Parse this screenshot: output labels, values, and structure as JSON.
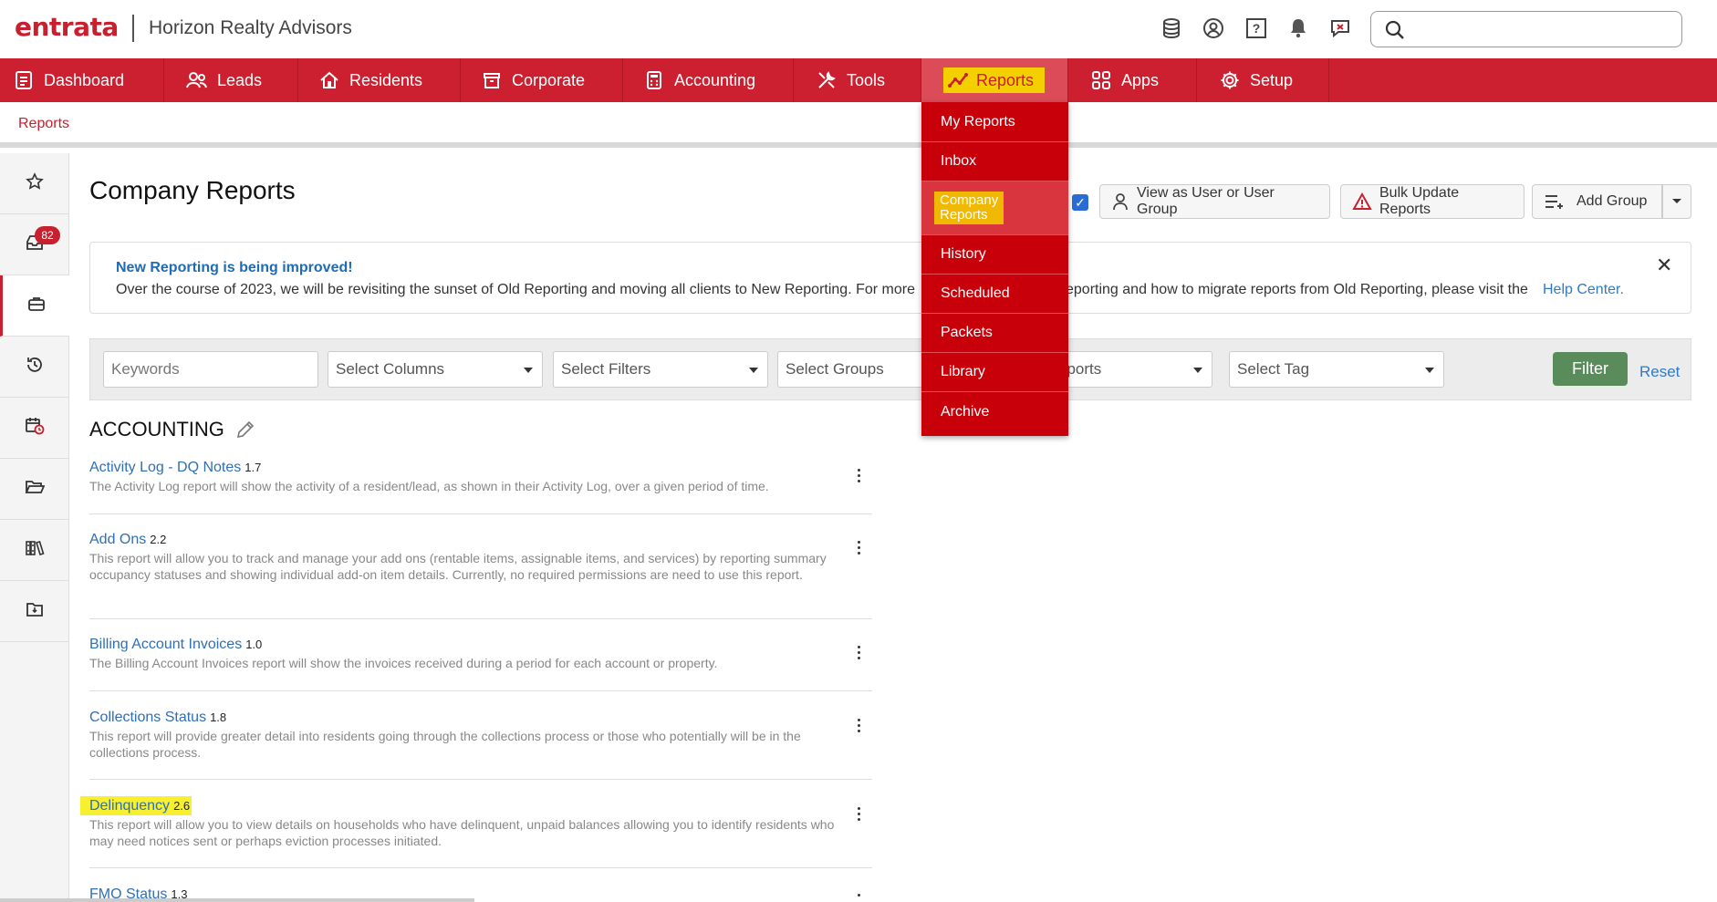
{
  "header": {
    "logo": "entrata",
    "company": "Horizon Realty Advisors",
    "icons": [
      "database-icon",
      "user-circle-icon",
      "help-icon",
      "bell-icon",
      "chat-icon"
    ],
    "search_placeholder": ""
  },
  "nav": {
    "items": [
      {
        "label": "Dashboard",
        "icon": "dashboard-icon"
      },
      {
        "label": "Leads",
        "icon": "leads-icon"
      },
      {
        "label": "Residents",
        "icon": "home-icon"
      },
      {
        "label": "Corporate",
        "icon": "corporate-icon"
      },
      {
        "label": "Accounting",
        "icon": "calculator-icon"
      },
      {
        "label": "Tools",
        "icon": "tools-icon"
      },
      {
        "label": "Reports",
        "icon": "reports-icon"
      },
      {
        "label": "Apps",
        "icon": "apps-icon"
      },
      {
        "label": "Setup",
        "icon": "gear-icon"
      }
    ],
    "active": "Reports"
  },
  "breadcrumb": "Reports",
  "rail": {
    "badge_count": "82"
  },
  "page": {
    "title": "Company Reports",
    "view_as_label": "View as User or User Group",
    "bulk_update_label": "Bulk Update Reports",
    "add_group_label": "Add Group"
  },
  "notice": {
    "title": "New Reporting is being improved!",
    "text_left": "Over the course of 2023, we will be revisiting the sunset of Old Reporting and moving all clients to New Reporting. For more",
    "text_right": "eporting and how to migrate reports from Old Reporting, please visit the",
    "link": "Help Center."
  },
  "filters": {
    "keywords_placeholder": "Keywords",
    "columns": "Select Columns",
    "filters": "Select Filters",
    "groups": "Select Groups",
    "reports": "eports",
    "tag": "Select Tag",
    "filter_button": "Filter",
    "reset": "Reset"
  },
  "section_title": "ACCOUNTING",
  "reports": [
    {
      "name": "Activity Log - DQ Notes",
      "version": "1.7",
      "desc": "The Activity Log report will show the activity of a resident/lead, as shown in their Activity Log, over a given period of time."
    },
    {
      "name": "Add Ons",
      "version": "2.2",
      "desc": "This report will allow you to track and manage your add ons (rentable items, assignable items, and services) by reporting summary occupancy statuses and showing individual add-on item details. Currently, no required permissions are need to use this report."
    },
    {
      "name": "Billing Account Invoices",
      "version": "1.0",
      "desc": "The Billing Account Invoices report will show the invoices received during a period for each account or property."
    },
    {
      "name": "Collections Status",
      "version": "1.8",
      "desc": "This report will provide greater detail into residents going through the collections process or those who potentially will be in the collections process."
    },
    {
      "name": "Delinquency",
      "version": "2.6",
      "desc": "This report will allow you to view details on households who have delinquent, unpaid balances allowing you to identify residents who may need notices sent or perhaps eviction processes initiated."
    },
    {
      "name": "FMO Status",
      "version": "1.3",
      "desc": ""
    }
  ],
  "reports_menu": {
    "items": [
      "My Reports",
      "Inbox",
      "Company Reports",
      "History",
      "Scheduled",
      "Packets",
      "Library",
      "Archive"
    ],
    "company_line1": "Company",
    "company_line2": "Reports"
  },
  "colors": {
    "brand_red": "#cc1f2f",
    "menu_red": "#c8000a",
    "link_blue": "#2f6fb5",
    "filter_green": "#5a8b5a",
    "highlight_yellow": "#f6ef32"
  }
}
